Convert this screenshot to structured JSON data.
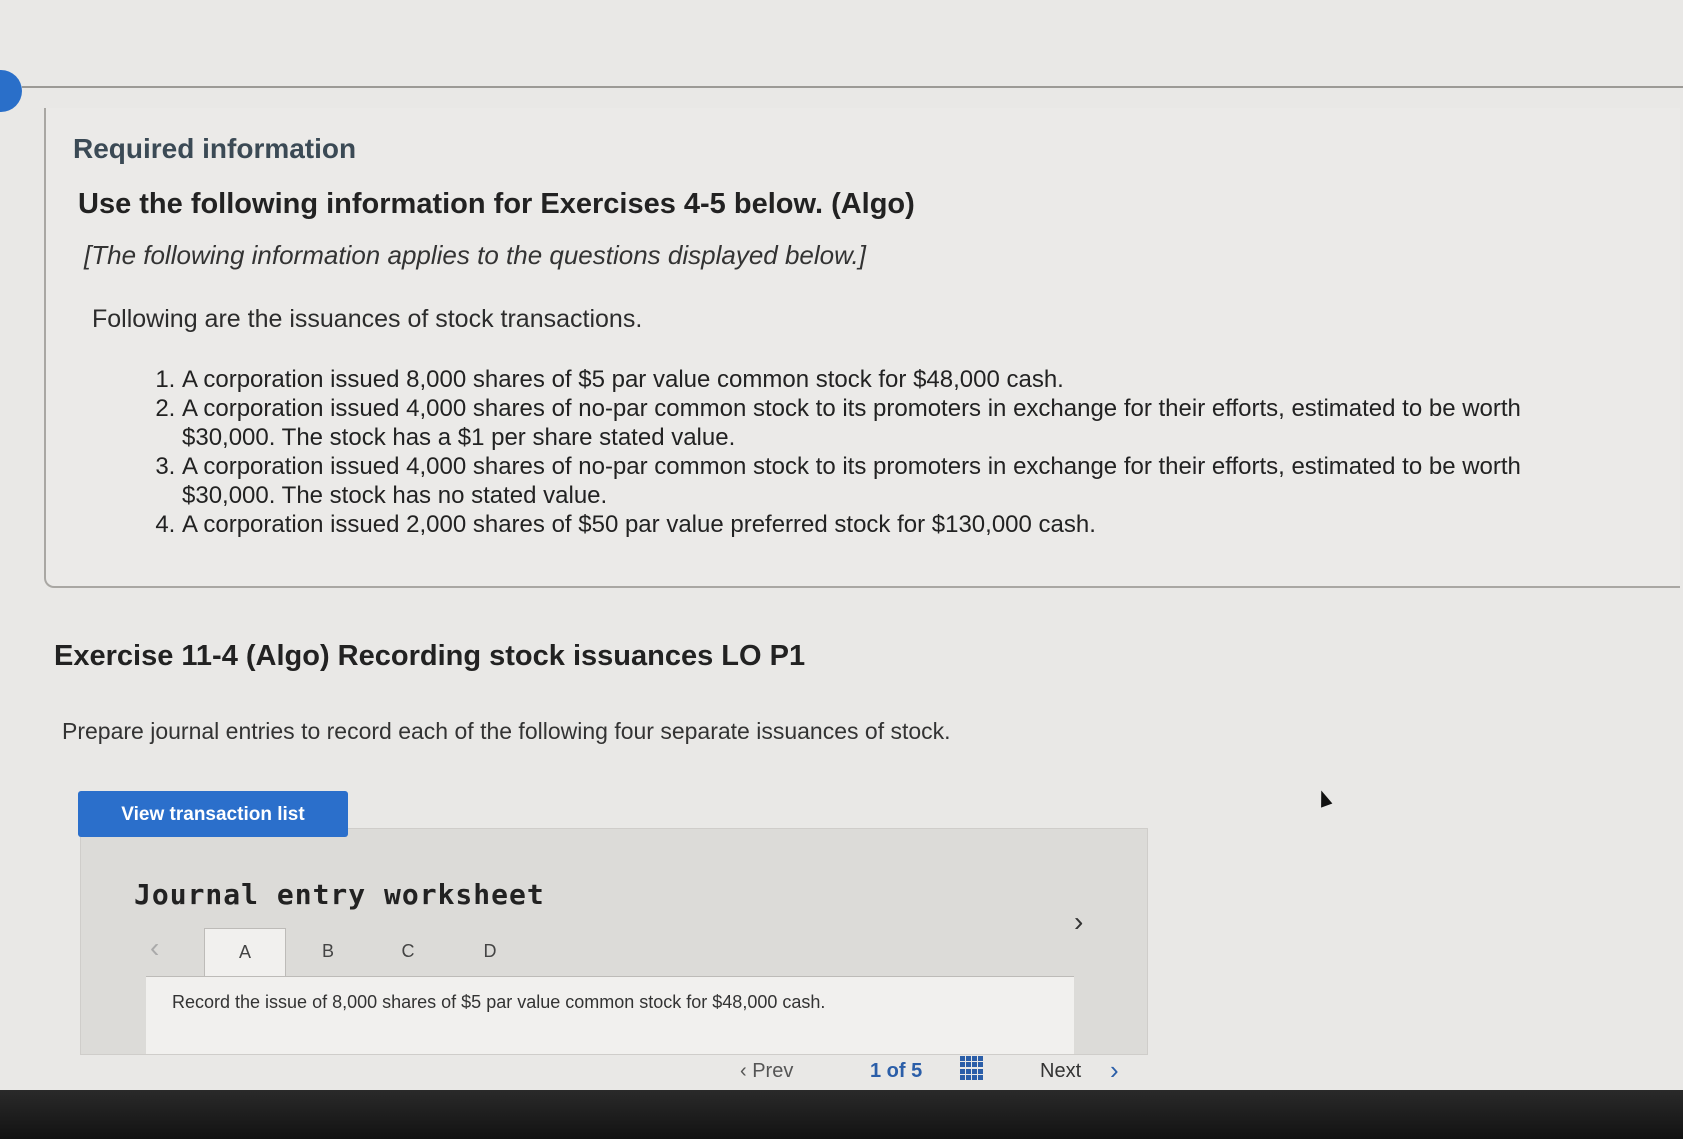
{
  "required_title": "Required information",
  "main_title": "Use the following information for Exercises 4-5 below. (Algo)",
  "sub_italic": "[The following information applies to the questions displayed below.]",
  "intro": "Following are the issuances of stock transactions.",
  "transactions": [
    "A corporation issued 8,000 shares of $5 par value common stock for $48,000 cash.",
    "A corporation issued 4,000 shares of no-par common stock to its promoters in exchange for their efforts, estimated to be worth $30,000. The stock has a $1 per share stated value.",
    "A corporation issued 4,000 shares of no-par common stock to its promoters in exchange for their efforts, estimated to be worth $30,000. The stock has no stated value.",
    "A corporation issued 2,000 shares of $50 par value preferred stock for $130,000 cash."
  ],
  "exercise_title": "Exercise 11-4 (Algo) Recording stock issuances LO P1",
  "prepare_text": "Prepare journal entries to record each of the following four separate issuances of stock.",
  "view_button": "View transaction list",
  "worksheet": {
    "title": "Journal entry worksheet",
    "tabs": [
      "A",
      "B",
      "C",
      "D"
    ],
    "active_tab": "A",
    "record_text": "Record the issue of 8,000 shares of $5 par value common stock for $48,000 cash."
  },
  "pager": {
    "prev_label": "Prev",
    "page_text": "1 of 5",
    "next_label": "Next"
  },
  "icons": {
    "prev_tab": "chevron-left-icon",
    "next_tab": "chevron-right-icon",
    "grid": "grid-icon",
    "next": "chevron-right-icon"
  }
}
